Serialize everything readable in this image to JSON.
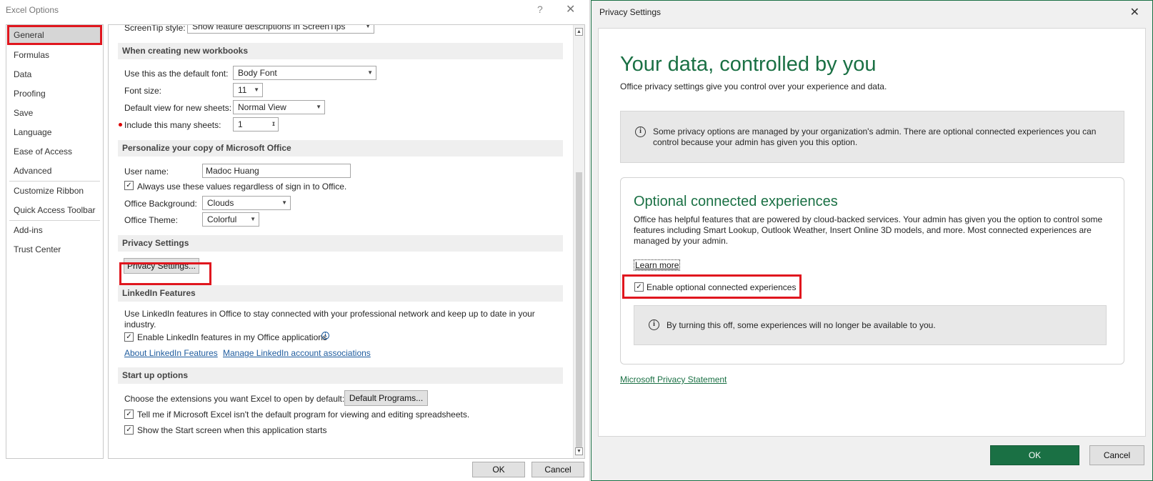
{
  "excel_options": {
    "title": "Excel Options",
    "help": "?",
    "close": "✕",
    "nav": [
      "General",
      "Formulas",
      "Data",
      "Proofing",
      "Save",
      "Language",
      "Ease of Access",
      "Advanced",
      "Customize Ribbon",
      "Quick Access Toolbar",
      "Add-ins",
      "Trust Center"
    ],
    "screentip_label": "ScreenTip style:",
    "screentip_value": "Show feature descriptions in ScreenTips",
    "sections": {
      "new_workbooks": "When creating new workbooks",
      "personalize": "Personalize your copy of Microsoft Office",
      "privacy": "Privacy Settings",
      "linkedin": "LinkedIn Features",
      "startup": "Start up options"
    },
    "default_font_label": "Use this as the default font:",
    "default_font_value": "Body Font",
    "font_size_label": "Font size:",
    "font_size_value": "11",
    "default_view_label": "Default view for new sheets:",
    "default_view_value": "Normal View",
    "sheets_label": "Include this many sheets:",
    "sheets_value": "1",
    "username_label": "User name:",
    "username_value": "Madoc Huang",
    "always_use_label": "Always use these values regardless of sign in to Office.",
    "background_label": "Office Background:",
    "background_value": "Clouds",
    "theme_label": "Office Theme:",
    "theme_value": "Colorful",
    "privacy_button": "Privacy Settings...",
    "linkedin_desc": "Use LinkedIn features in Office to stay connected with your professional network and keep up to date in your industry.",
    "linkedin_enable_label": "Enable LinkedIn features in my Office applications",
    "about_linkedin": "About LinkedIn Features",
    "manage_linkedin": "Manage LinkedIn account associations",
    "extensions_label": "Choose the extensions you want Excel to open by default:",
    "default_programs_button": "Default Programs...",
    "tell_me_label": "Tell me if Microsoft Excel isn't the default program for viewing and editing spreadsheets.",
    "show_start_label": "Show the Start screen when this application starts",
    "ok": "OK",
    "cancel": "Cancel"
  },
  "privacy_settings": {
    "title": "Privacy Settings",
    "close": "✕",
    "heading": "Your data, controlled by you",
    "subheading": "Office privacy settings give you control over your experience and data.",
    "admin_notice": "Some privacy options are managed by your organization's admin. There are optional connected experiences you can control because your admin has given you this option.",
    "card_heading": "Optional connected experiences",
    "card_desc": "Office has helpful features that are powered by cloud-backed services. Your admin has given you the option to control some features including Smart Lookup, Outlook Weather, Insert Online 3D models, and more. Most connected experiences are managed by your admin.",
    "learn_more": "Learn more",
    "enable_label": "Enable optional connected experiences",
    "warning": "By turning this off, some experiences will no longer be available to you.",
    "privacy_statement": "Microsoft Privacy Statement",
    "ok": "OK",
    "cancel": "Cancel"
  },
  "icons": {
    "info": "i",
    "check": "✓",
    "arrow_down": "▼",
    "arrow_up": "▲"
  },
  "colors": {
    "accent_green": "#1a7044",
    "highlight_red": "#e0161e",
    "link_blue": "#1f5c9e"
  }
}
